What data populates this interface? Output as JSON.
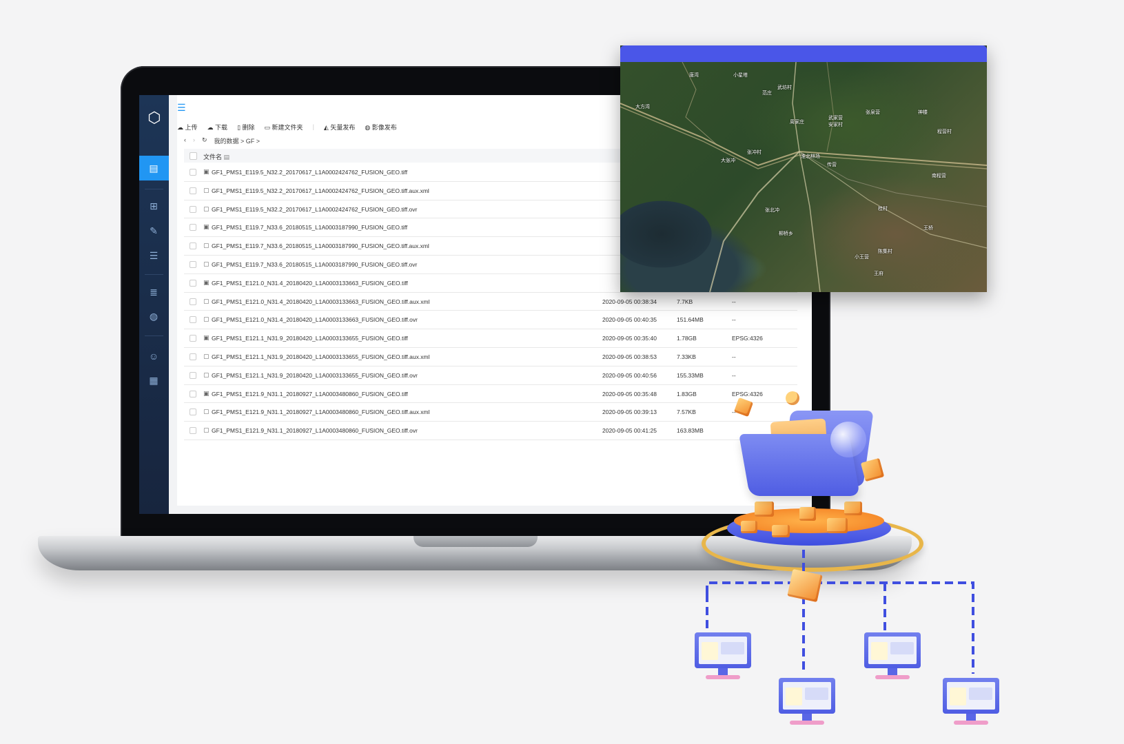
{
  "toolbar": {
    "upload": "上传",
    "download": "下载",
    "delete": "删除",
    "new_folder": "新建文件夹",
    "vector_publish": "矢量发布",
    "image_publish": "影像发布"
  },
  "breadcrumb": {
    "back": "‹",
    "forward": "›",
    "refresh": "↻",
    "path": "我的数据 > GF >"
  },
  "table": {
    "header_name": "文件名",
    "rows": [
      {
        "icon": "image-file-icon",
        "name": "GF1_PMS1_E119.5_N32.2_20170617_L1A0002424762_FUSION_GEO.tiff",
        "time": "",
        "size": "",
        "crs": ""
      },
      {
        "icon": "doc-file-icon",
        "name": "GF1_PMS1_E119.5_N32.2_20170617_L1A0002424762_FUSION_GEO.tiff.aux.xml",
        "time": "",
        "size": "",
        "crs": ""
      },
      {
        "icon": "doc-file-icon",
        "name": "GF1_PMS1_E119.5_N32.2_20170617_L1A0002424762_FUSION_GEO.tiff.ovr",
        "time": "",
        "size": "",
        "crs": ""
      },
      {
        "icon": "image-file-icon",
        "name": "GF1_PMS1_E119.7_N33.6_20180515_L1A0003187990_FUSION_GEO.tiff",
        "time": "",
        "size": "",
        "crs": ""
      },
      {
        "icon": "doc-file-icon",
        "name": "GF1_PMS1_E119.7_N33.6_20180515_L1A0003187990_FUSION_GEO.tiff.aux.xml",
        "time": "",
        "size": "",
        "crs": ""
      },
      {
        "icon": "doc-file-icon",
        "name": "GF1_PMS1_E119.7_N33.6_20180515_L1A0003187990_FUSION_GEO.tiff.ovr",
        "time": "",
        "size": "",
        "crs": ""
      },
      {
        "icon": "image-file-icon",
        "name": "GF1_PMS1_E121.0_N31.4_20180420_L1A0003133663_FUSION_GEO.tiff",
        "time": "",
        "size": "",
        "crs": ""
      },
      {
        "icon": "doc-file-icon",
        "name": "GF1_PMS1_E121.0_N31.4_20180420_L1A0003133663_FUSION_GEO.tiff.aux.xml",
        "time": "2020-09-05 00:38:34",
        "size": "7.7KB",
        "crs": "--"
      },
      {
        "icon": "doc-file-icon",
        "name": "GF1_PMS1_E121.0_N31.4_20180420_L1A0003133663_FUSION_GEO.tiff.ovr",
        "time": "2020-09-05 00:40:35",
        "size": "151.64MB",
        "crs": "--"
      },
      {
        "icon": "image-file-icon",
        "name": "GF1_PMS1_E121.1_N31.9_20180420_L1A0003133655_FUSION_GEO.tiff",
        "time": "2020-09-05 00:35:40",
        "size": "1.78GB",
        "crs": "EPSG:4326"
      },
      {
        "icon": "doc-file-icon",
        "name": "GF1_PMS1_E121.1_N31.9_20180420_L1A0003133655_FUSION_GEO.tiff.aux.xml",
        "time": "2020-09-05 00:38:53",
        "size": "7.33KB",
        "crs": "--"
      },
      {
        "icon": "doc-file-icon",
        "name": "GF1_PMS1_E121.1_N31.9_20180420_L1A0003133655_FUSION_GEO.tiff.ovr",
        "time": "2020-09-05 00:40:56",
        "size": "155.33MB",
        "crs": "--"
      },
      {
        "icon": "image-file-icon",
        "name": "GF1_PMS1_E121.9_N31.1_20180927_L1A0003480860_FUSION_GEO.tiff",
        "time": "2020-09-05 00:35:48",
        "size": "1.83GB",
        "crs": "EPSG:4326"
      },
      {
        "icon": "doc-file-icon",
        "name": "GF1_PMS1_E121.9_N31.1_20180927_L1A0003480860_FUSION_GEO.tiff.aux.xml",
        "time": "2020-09-05 00:39:13",
        "size": "7.57KB",
        "crs": "--"
      },
      {
        "icon": "doc-file-icon",
        "name": "GF1_PMS1_E121.9_N31.1_20180927_L1A0003480860_FUSION_GEO.tiff.ovr",
        "time": "2020-09-05 00:41:25",
        "size": "163.83MB",
        "crs": ""
      }
    ]
  },
  "map": {
    "labels": [
      "唐湾",
      "小星塔",
      "武坊村",
      "范庄",
      "大方湾",
      "武家营",
      "张泉营",
      "神楼",
      "程营村",
      "周家庄",
      "安家村",
      "张冲村",
      "大张冲",
      "淮北林场",
      "传营",
      "南程营",
      "张北冲",
      "桂村",
      "王桥",
      "柳桥乡",
      "陈集村",
      "小王营",
      "王府"
    ]
  },
  "colors": {
    "sidebar_bg": "#1d3556",
    "sidebar_active": "#2196f3",
    "map_titlebar": "#4a56e8",
    "accent_orange": "#f2892a",
    "network_line": "#3f4ee0"
  }
}
